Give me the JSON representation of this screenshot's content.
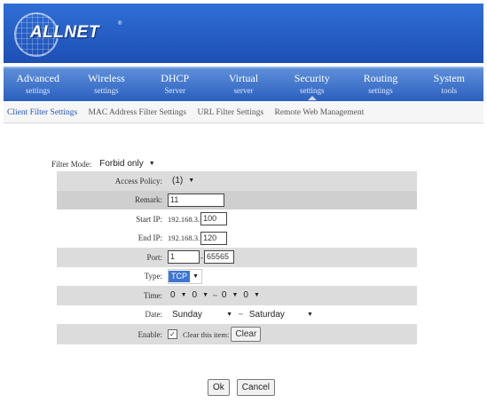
{
  "header": {
    "brand": "ALLNET",
    "registered": "®"
  },
  "nav": {
    "items": [
      {
        "line1": "Advanced",
        "line2": "settings"
      },
      {
        "line1": "Wireless",
        "line2": "settings"
      },
      {
        "line1": "DHCP",
        "line2": "Server"
      },
      {
        "line1": "Virtual",
        "line2": "server"
      },
      {
        "line1": "Security",
        "line2": "settings"
      },
      {
        "line1": "Routing",
        "line2": "settings"
      },
      {
        "line1": "System",
        "line2": "tools"
      }
    ],
    "active_index": 4
  },
  "subnav": {
    "items": [
      "Client Filter Settings",
      "MAC Address Filter Settings",
      "URL Filter Settings",
      "Remote Web Management"
    ]
  },
  "form": {
    "filter_mode_label": "Filter Mode:",
    "filter_mode_value": "Forbid only",
    "access_policy_label": "Access Policy:",
    "access_policy_value": "(1)",
    "remark_label": "Remark:",
    "remark_value": "11",
    "start_ip_label": "Start IP:",
    "start_ip_prefix": "192.168.3.",
    "start_ip_value": "100",
    "end_ip_label": "End IP:",
    "end_ip_prefix": "192.168.3.",
    "end_ip_value": "120",
    "port_label": "Port:",
    "port_from": "1",
    "port_sep": "-",
    "port_to": "65565",
    "type_label": "Type:",
    "type_value": "TCP",
    "time_label": "Time:",
    "time_h1": "0",
    "time_m1": "0",
    "time_sep": "~",
    "time_h2": "0",
    "time_m2": "0",
    "date_label": "Date:",
    "date_from": "Sunday",
    "date_sep": "~",
    "date_to": "Saturday",
    "enable_label": "Enable:",
    "enable_checked": "✓",
    "clear_item_label": "Clear this item:",
    "clear_button": "Clear"
  },
  "actions": {
    "ok": "Ok",
    "cancel": "Cancel"
  },
  "colors": {
    "header_blue": "#1d4fb4",
    "nav_blue": "#2a5fbf",
    "row_shade": "#dcdcdc",
    "highlight": "#3d74d6"
  },
  "icons": {
    "dropdown": "dropdown-arrow-icon",
    "checkbox": "checkbox-icon",
    "logo": "globe-logo-icon"
  }
}
